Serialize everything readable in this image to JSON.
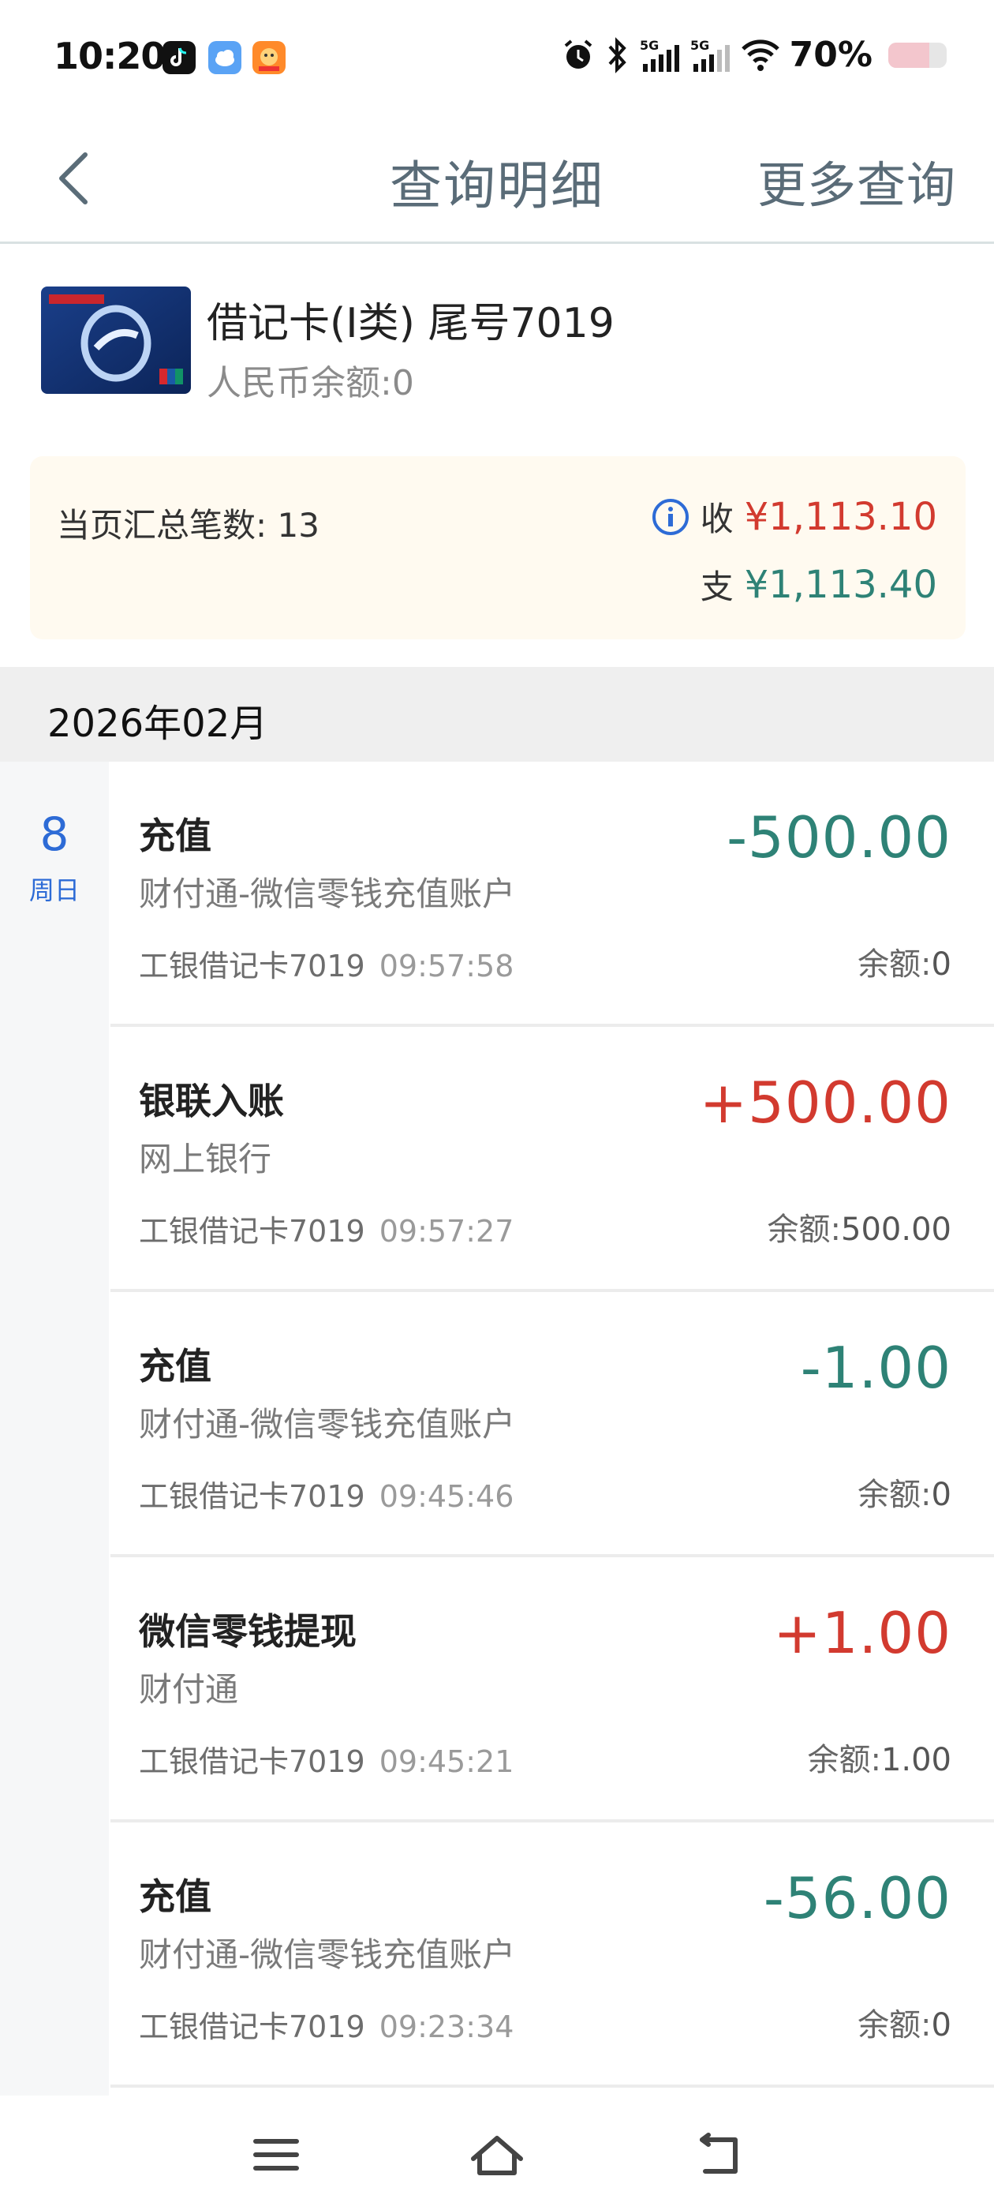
{
  "status_bar": {
    "time": "10:20",
    "battery_text": "70%",
    "battery_level": 0.7,
    "icons": [
      "tiktok-icon",
      "cloud-app-icon",
      "mascot-app-icon",
      "alarm-icon",
      "bluetooth-icon",
      "signal-5g-icon",
      "signal-5g-icon",
      "wifi-icon",
      "battery-icon"
    ]
  },
  "nav": {
    "title": "查询明细",
    "more": "更多查询",
    "back_icon": "chevron-left-icon"
  },
  "card": {
    "title": "借记卡(Ⅰ类) 尾号7019",
    "balance": "人民币余额:0",
    "logo_text": "ICBC 中国工商银行"
  },
  "summary": {
    "count_label": "当页汇总笔数: 13",
    "income_label": "收",
    "income": "¥1,113.10",
    "expense_label": "支",
    "expense": "¥1,113.40"
  },
  "month": "2026年02月",
  "date": {
    "day": "8",
    "weekday": "周日"
  },
  "transactions": [
    {
      "title": "充值",
      "desc": "财付通-微信零钱充值账户",
      "card": "工银借记卡7019",
      "time": "09:57:58",
      "amount": "-500.00",
      "sign": "neg",
      "balance_label": "余额:",
      "balance": "0"
    },
    {
      "title": "银联入账",
      "desc": "网上银行",
      "card": "工银借记卡7019",
      "time": "09:57:27",
      "amount": "+500.00",
      "sign": "pos",
      "balance_label": "余额:",
      "balance": "500.00"
    },
    {
      "title": "充值",
      "desc": "财付通-微信零钱充值账户",
      "card": "工银借记卡7019",
      "time": "09:45:46",
      "amount": "-1.00",
      "sign": "neg",
      "balance_label": "余额:",
      "balance": "0"
    },
    {
      "title": "微信零钱提现",
      "desc": "财付通",
      "card": "工银借记卡7019",
      "time": "09:45:21",
      "amount": "+1.00",
      "sign": "pos",
      "balance_label": "余额:",
      "balance": "1.00"
    },
    {
      "title": "充值",
      "desc": "财付通-微信零钱充值账户",
      "card": "工银借记卡7019",
      "time": "09:23:34",
      "amount": "-56.00",
      "sign": "neg",
      "balance_label": "余额:",
      "balance": "0"
    }
  ],
  "colors": {
    "income": "#d23a2f",
    "expense": "#2e8276",
    "date_accent": "#2d6bd6",
    "nav_text": "#5a6c78"
  },
  "bottom_nav": [
    "menu-icon",
    "home-icon",
    "back-icon"
  ]
}
